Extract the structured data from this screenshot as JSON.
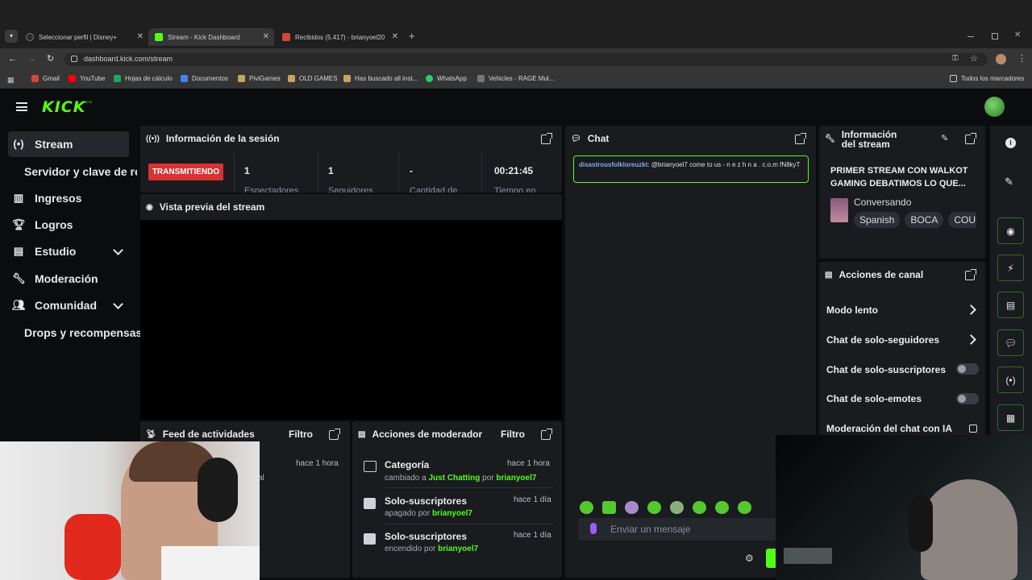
{
  "browser": {
    "tabs": [
      {
        "title": "Seleccionar perfil | Disney+"
      },
      {
        "title": "Stream - Kick Dashboard"
      },
      {
        "title": "Recibidos (5.417) - brianyoel20"
      }
    ],
    "new_tab": "+",
    "url": "dashboard.kick.com/stream",
    "bookmarks": [
      "Gmail",
      "YouTube",
      "Hojas de cálculo",
      "Documentos",
      "PiviGames",
      "OLD GAMES",
      "Has buscado all inst...",
      "WhatsApp",
      "Vehicles - RAGE Mul..."
    ],
    "all_bookmarks": "Todos los marcadores"
  },
  "brand": {
    "logo": "KICK",
    "beta": "BETA",
    "accent": "#53fc18"
  },
  "sidebar": {
    "items": [
      {
        "label": "Stream",
        "icon": "broadcast-icon"
      },
      {
        "label": "Servidor y clave de ret"
      },
      {
        "label": "Ingresos",
        "icon": "revenue-icon"
      },
      {
        "label": "Logros",
        "icon": "trophy-icon"
      },
      {
        "label": "Estudio",
        "icon": "studio-icon"
      },
      {
        "label": "Moderación",
        "icon": "wrench-icon"
      },
      {
        "label": "Comunidad",
        "icon": "community-icon"
      },
      {
        "label": "Drops y recompensas"
      }
    ]
  },
  "session": {
    "title": "Información de la sesión",
    "status": "TRANSMITIENDO",
    "stats": [
      {
        "value": "1",
        "label": "Espectadores"
      },
      {
        "value": "1",
        "label": "Seguidores"
      },
      {
        "value": "-",
        "label": "Cantidad de"
      },
      {
        "value": "00:21:45",
        "label": "Tiempo en"
      }
    ]
  },
  "preview": {
    "title": "Vista previa del stream"
  },
  "activity": {
    "title": "Feed de actividades",
    "filter": "Filtro",
    "time": "hace 1 hora",
    "partial": "al"
  },
  "mod_actions": {
    "title": "Acciones de moderador",
    "filter": "Filtro",
    "items": [
      {
        "title": "Categoría",
        "time": "hace 1 hora",
        "pre": "cambiado a",
        "target": "Just Chatting",
        "by": "por",
        "user": "brianyoel7"
      },
      {
        "title": "Solo-suscriptores",
        "time": "hace 1 día",
        "pre": "apagado",
        "target": "",
        "by": "por",
        "user": "brianyoel7"
      },
      {
        "title": "Solo-suscriptores",
        "time": "hace 1 día",
        "pre": "encendido",
        "target": "",
        "by": "por",
        "user": "brianyoel7"
      }
    ]
  },
  "chat": {
    "title": "Chat",
    "message": {
      "user": "disastrousfolkloreuzkt",
      "text": ": @brianyoel7 come to us - n e z h n a . c.o.m fN8kyT"
    },
    "input_placeholder": "Enviar un mensaje"
  },
  "stream_info": {
    "title": "Información del stream",
    "stream_title": "PRIMER STREAM CON WALKOT GAMING DEBATIMOS LO QUE...",
    "category": "Conversando",
    "tags": [
      "Spanish",
      "BOCA",
      "COU"
    ]
  },
  "channel_actions": {
    "title": "Acciones de canal",
    "items": [
      {
        "label": "Modo lento",
        "control": "chevron"
      },
      {
        "label": "Chat de solo-seguidores",
        "control": "chevron"
      },
      {
        "label": "Chat de solo-suscriptores",
        "control": "toggle-off"
      },
      {
        "label": "Chat de solo-emotes",
        "control": "toggle-off"
      },
      {
        "label": "Moderación del chat con IA",
        "control": "link"
      }
    ]
  }
}
